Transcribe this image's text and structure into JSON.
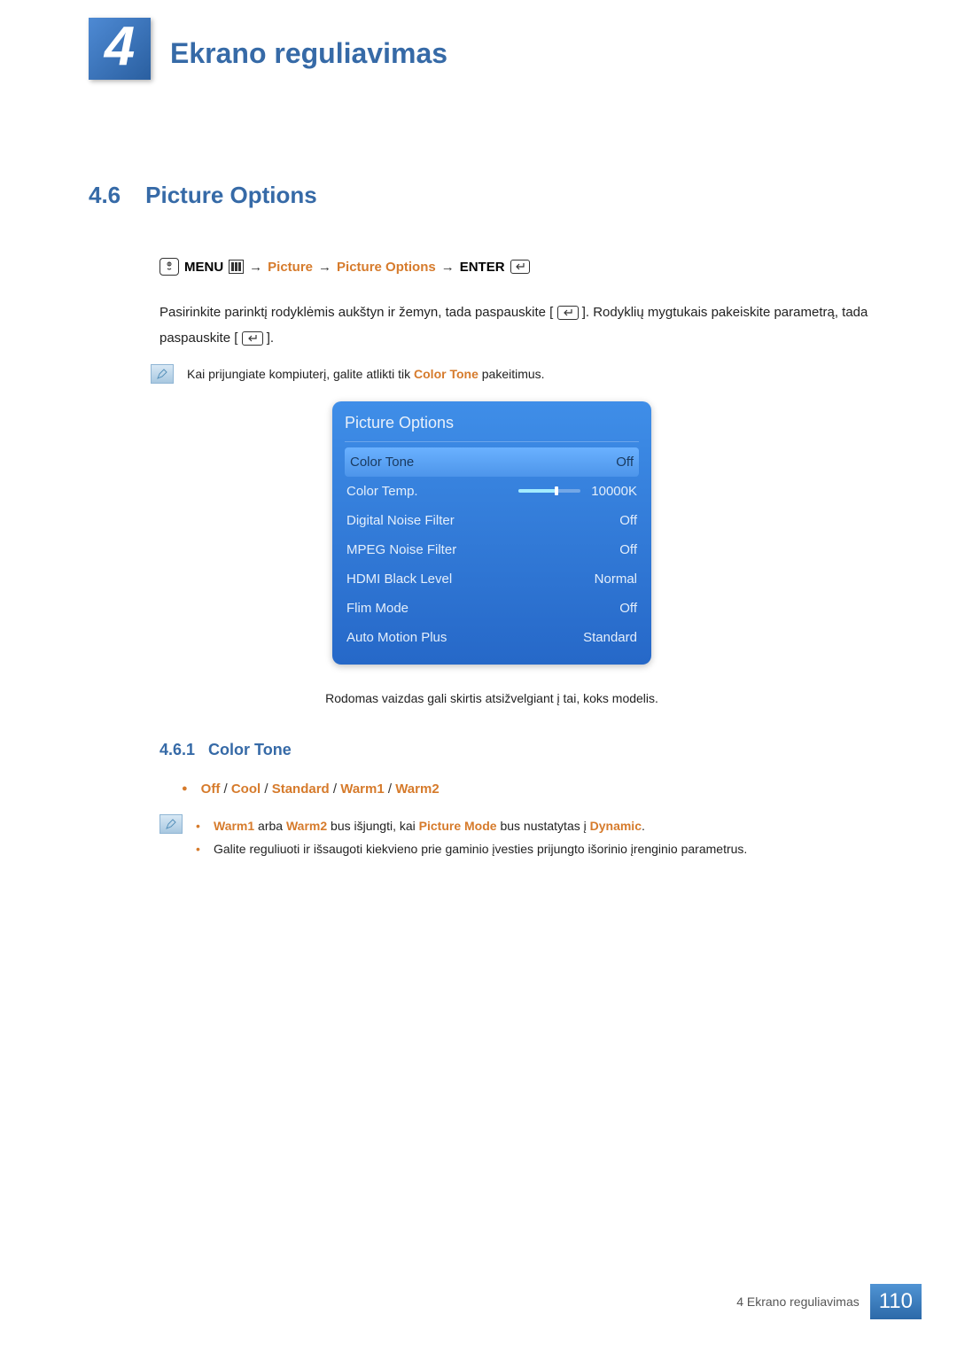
{
  "header": {
    "chapter_number": "4",
    "chapter_title": "Ekrano reguliavimas"
  },
  "section": {
    "number": "4.6",
    "title": "Picture Options"
  },
  "menu_path": {
    "menu": "MENU",
    "p1": "Picture",
    "p2": "Picture Options",
    "enter": "ENTER"
  },
  "body": {
    "para1a": "Pasirinkite parinktį rodyklėmis aukštyn ir žemyn, tada paspauskite [",
    "para1b": "]. Rodyklių mygtukais pakeiskite parametrą, tada paspauskite [",
    "para1c": "].",
    "note1a": "Kai prijungiate kompiuterį, galite atlikti tik ",
    "note1_hl": "Color Tone",
    "note1b": " pakeitimus."
  },
  "osd": {
    "title": "Picture Options",
    "rows": [
      {
        "label": "Color Tone",
        "value": "Off",
        "selected": true,
        "slider": false
      },
      {
        "label": "Color Temp.",
        "value": "10000K",
        "selected": false,
        "slider": true
      },
      {
        "label": "Digital Noise Filter",
        "value": "Off",
        "selected": false,
        "slider": false
      },
      {
        "label": "MPEG Noise Filter",
        "value": "Off",
        "selected": false,
        "slider": false
      },
      {
        "label": "HDMI Black Level",
        "value": "Normal",
        "selected": false,
        "slider": false
      },
      {
        "label": "Flim Mode",
        "value": "Off",
        "selected": false,
        "slider": false
      },
      {
        "label": "Auto Motion Plus",
        "value": "Standard",
        "selected": false,
        "slider": false
      }
    ]
  },
  "caption": "Rodomas vaizdas gali skirtis atsižvelgiant į tai, koks modelis.",
  "subsection": {
    "number": "4.6.1",
    "title": "Color Tone"
  },
  "options": [
    "Off",
    "Cool",
    "Standard",
    "Warm1",
    "Warm2"
  ],
  "sep": " / ",
  "notes2": {
    "li1_a": "Warm1",
    "li1_b": " arba ",
    "li1_c": "Warm2",
    "li1_d": " bus išjungti, kai ",
    "li1_e": "Picture Mode",
    "li1_f": " bus nustatytas į ",
    "li1_g": "Dynamic",
    "li1_h": ".",
    "li2": "Galite reguliuoti ir išsaugoti kiekvieno prie gaminio įvesties prijungto išorinio įrenginio parametrus."
  },
  "footer": {
    "text": "4 Ekrano reguliavimas",
    "page": "110"
  }
}
